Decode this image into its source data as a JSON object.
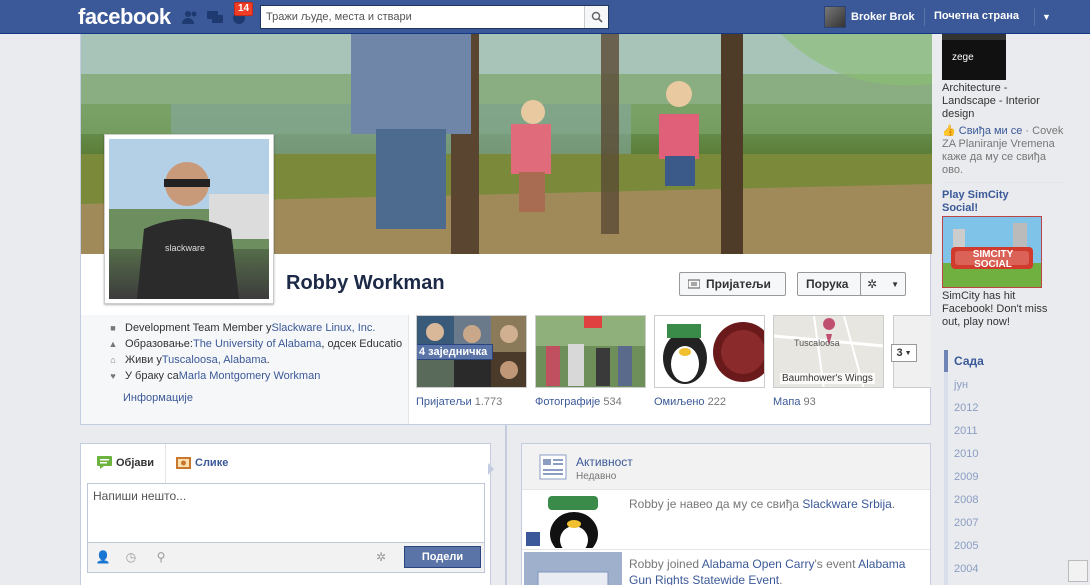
{
  "topbar": {
    "logo": "facebook",
    "notification_count": "14",
    "search_placeholder": "Тражи људе, места и ствари",
    "user_name": "Broker Brok",
    "home_label": "Почетна страна"
  },
  "profile": {
    "name": "Robby Workman",
    "friends_button": "Пријатељи",
    "message_button": "Порука",
    "info": [
      {
        "icon": "briefcase-icon",
        "prefix": "Development Team Member у ",
        "link": "Slackware Linux, Inc."
      },
      {
        "icon": "graduation-cap-icon",
        "prefix": "Образовање: ",
        "link": "The University of Alabama",
        "suffix": ", одсек Educatio"
      },
      {
        "icon": "house-icon",
        "prefix": "Живи у ",
        "link": "Tuscaloosa, Alabama",
        "suffix": "."
      },
      {
        "icon": "heart-icon",
        "prefix": "У браку са ",
        "link": "Marla Montgomery Workman"
      }
    ],
    "info_more": "Информације",
    "mutual_friends": "4 заједничка",
    "map_label": "Baumhower's Wings",
    "map_city": "Tuscaloosa",
    "sections": [
      {
        "label": "Пријатељи",
        "count": "1.773"
      },
      {
        "label": "Фотографије",
        "count": "534"
      },
      {
        "label": "Омиљено",
        "count": "222"
      },
      {
        "label": "Мапа",
        "count": "93"
      }
    ],
    "more_count": "3"
  },
  "composer": {
    "tab_post": "Објави",
    "tab_photos": "Слике",
    "placeholder": "Напиши нешто...",
    "share_button": "Подели"
  },
  "activity": {
    "title": "Активност",
    "subtitle": "Недавно",
    "items": [
      {
        "actor": "Robby",
        "text": " је навео да му се свиђа ",
        "link": "Slackware Srbija",
        "end": "."
      },
      {
        "actor": "Robby",
        "text": " joined ",
        "link": "Alabama Open Carry",
        "text2": "'s event ",
        "link2": "Alabama Gun Rights Statewide Event",
        "end": "."
      }
    ]
  },
  "sidebar": {
    "ad1_title": "Architecture - Landscape - Interior design",
    "ad1_like": "Свиђа ми се",
    "ad1_social": " · Covek ZA Planiranje Vremena каже да му се свиђа ово.",
    "ad2_title": "Play SimCity Social!",
    "ad2_text": "SimCity has hit Facebook! Don't miss out, play now!",
    "ad2_image_text": "SIMCITY SOCIAL"
  },
  "timeline": {
    "now": "Сада",
    "months": [
      "јун"
    ],
    "years": [
      "2012",
      "2011",
      "2010",
      "2009",
      "2008",
      "2007",
      "2005",
      "2004"
    ]
  },
  "colors": {
    "brand": "#3b5998",
    "badge": "#f03d25",
    "share": "#5b74a8"
  }
}
